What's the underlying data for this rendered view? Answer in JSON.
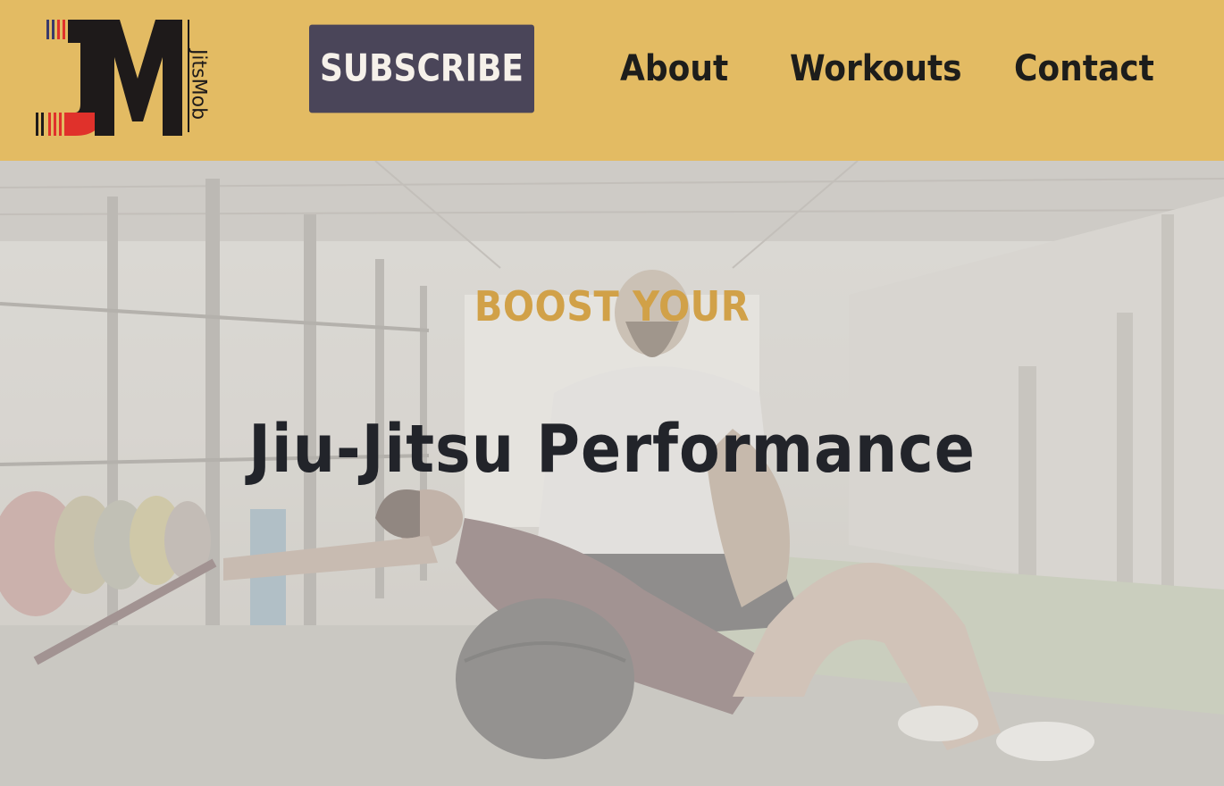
{
  "brand": {
    "logo_letters": "JM",
    "logo_wordmark": "JitsMob",
    "colors": {
      "red": "#e0312b",
      "black": "#1e1a1a",
      "navy": "#3a3a6b",
      "yellow": "#e3bb63"
    }
  },
  "header": {
    "background": "#e3bb63",
    "subscribe_label": "SUBSCRIBE",
    "nav": [
      "About",
      "Workouts",
      "Contact"
    ]
  },
  "hero": {
    "eyebrow": "BOOST YOUR",
    "headline": "Jiu-Jitsu Performance",
    "eyebrow_color": "#d1a148",
    "headline_color": "#22242a"
  }
}
